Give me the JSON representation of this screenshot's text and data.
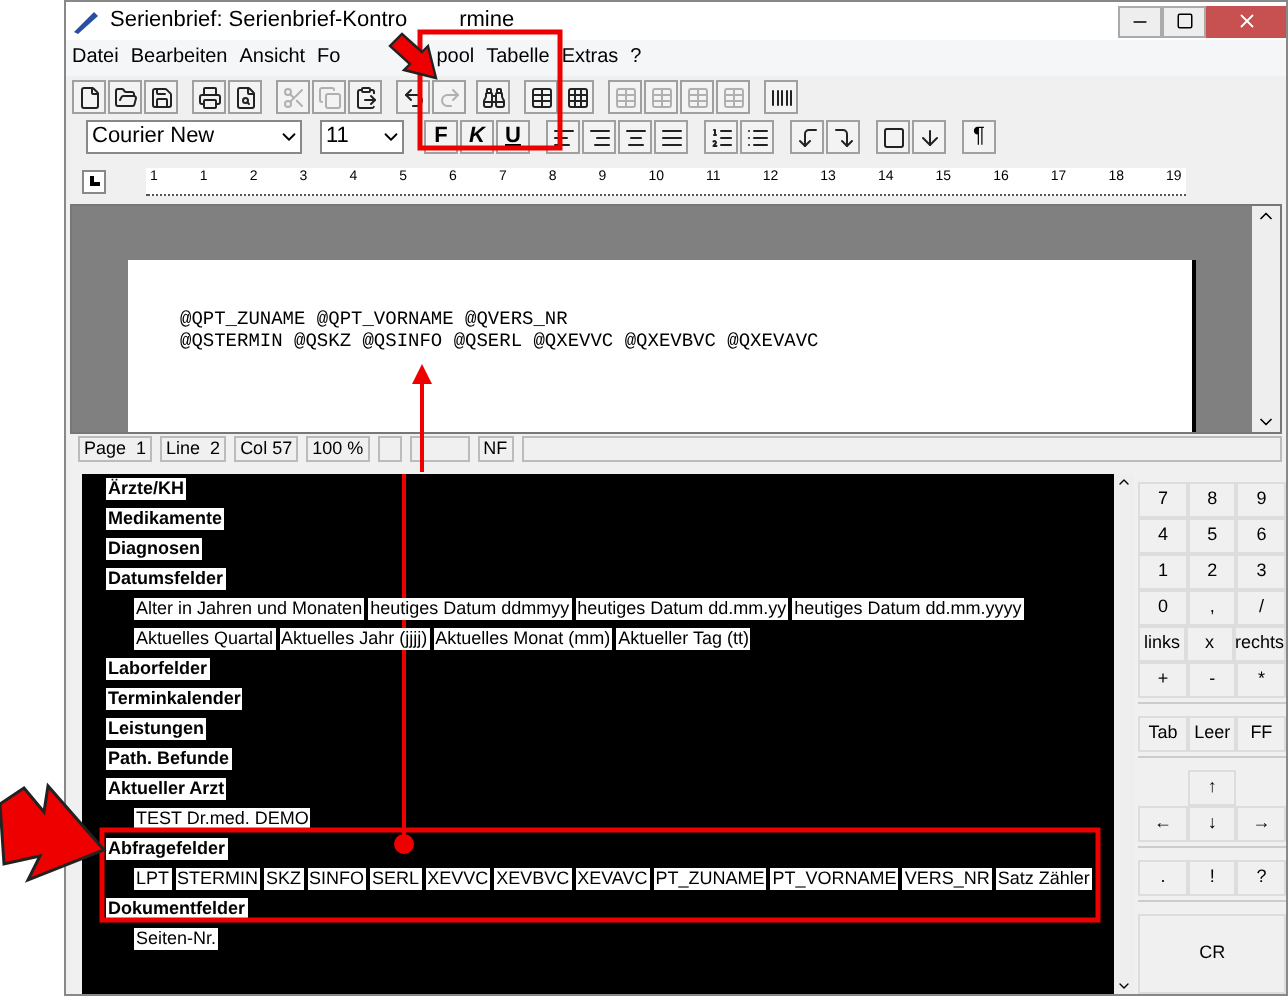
{
  "window": {
    "title": "Serienbrief: Serienbrief-Kontro",
    "title_tail": "rmine"
  },
  "menu": [
    "Datei",
    "Bearbeiten",
    "Ansicht",
    "Fo",
    "pool",
    "Tabelle",
    "Extras",
    "?"
  ],
  "format_bar": {
    "font": "Courier New",
    "size": "11",
    "style_buttons": [
      {
        "label": "F",
        "kind": "bold"
      },
      {
        "label": "K",
        "kind": "italic"
      },
      {
        "label": "U",
        "kind": "underline"
      }
    ],
    "paragraph_mark": "¶"
  },
  "ruler": {
    "labels": [
      "1",
      "1",
      "2",
      "3",
      "4",
      "5",
      "6",
      "7",
      "8",
      "9",
      "10",
      "11",
      "12",
      "13",
      "14",
      "15",
      "16",
      "17",
      "18",
      "19"
    ]
  },
  "document": {
    "lines": [
      "@QPT_ZUNAME @QPT_VORNAME @QVERS_NR",
      "@QSTERMIN @QSKZ @QSINFO @QSERL @QXEVVC @QXEVBVC @QXEVAVC"
    ]
  },
  "status_bar": [
    "Page  1",
    "Line  2",
    "Col 57",
    "100 %",
    "NF"
  ],
  "field_list": [
    {
      "title": "Ärzte/KH"
    },
    {
      "title": "Medikamente"
    },
    {
      "title": "Diagnosen"
    },
    {
      "title": "Datumsfelder",
      "lines": [
        {
          "chips": [
            "Alter in Jahren und Monaten",
            "heutiges Datum ddmmyy",
            "heutiges Datum dd.mm.yy",
            "heutiges Datum dd.mm.yyyy"
          ]
        },
        {
          "chips": [
            "Aktuelles Quartal",
            "Aktuelles Jahr (jjjj)",
            "Aktuelles Monat (mm)",
            "Aktueller Tag (tt)"
          ]
        }
      ]
    },
    {
      "title": "Laborfelder"
    },
    {
      "title": "Terminkalender"
    },
    {
      "title": "Leistungen"
    },
    {
      "title": "Path. Befunde"
    },
    {
      "title": "Aktueller Arzt",
      "lines": [
        {
          "chips": [
            "TEST Dr.med. DEMO"
          ]
        }
      ]
    },
    {
      "title": "Abfragefelder",
      "lines": [
        {
          "chips": [
            "LPT",
            "STERMIN",
            "SKZ",
            "SINFO",
            "SERL",
            "XEVVC",
            "XEVBVC",
            "XEVAVC",
            "PT_ZUNAME",
            "PT_VORNAME",
            "VERS_NR",
            "Satz Zähler"
          ]
        }
      ]
    },
    {
      "title": "Dokumentfelder",
      "lines": [
        {
          "chips": [
            "Seiten-Nr."
          ]
        }
      ]
    }
  ],
  "keypad": [
    {
      "kind": "keys",
      "keys": [
        "7",
        "8",
        "9"
      ]
    },
    {
      "kind": "keys",
      "keys": [
        "4",
        "5",
        "6"
      ]
    },
    {
      "kind": "keys",
      "keys": [
        "1",
        "2",
        "3"
      ]
    },
    {
      "kind": "keys",
      "keys": [
        "0",
        ",",
        "/"
      ]
    },
    {
      "kind": "keys",
      "keys": [
        "links",
        "x",
        "rechts"
      ]
    },
    {
      "kind": "keys",
      "keys": [
        "+",
        "-",
        "*"
      ]
    },
    {
      "kind": "gap"
    },
    {
      "kind": "keys",
      "keys": [
        "Tab",
        "Leer",
        "FF"
      ]
    },
    {
      "kind": "gap"
    },
    {
      "kind": "arrows",
      "keys": [
        "↑"
      ]
    },
    {
      "kind": "keys",
      "keys": [
        "←",
        "↓",
        "→"
      ]
    },
    {
      "kind": "gap"
    },
    {
      "kind": "keys",
      "keys": [
        ".",
        "!",
        "?"
      ]
    },
    {
      "kind": "gap"
    },
    {
      "kind": "keys",
      "keys": [
        "CR"
      ]
    }
  ]
}
